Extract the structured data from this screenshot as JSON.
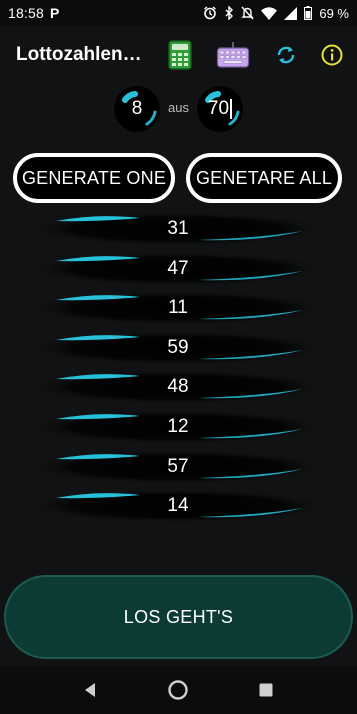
{
  "status_bar": {
    "time": "18:58",
    "app_badge": "P",
    "battery_text": "69 %",
    "icons": [
      "alarm-icon",
      "bluetooth-icon",
      "mute-icon",
      "wifi-icon",
      "signal-icon",
      "battery-icon"
    ]
  },
  "app_bar": {
    "title": "Lottozahlen…",
    "actions": [
      "calculator-icon",
      "keyboard-icon",
      "refresh-icon",
      "info-icon"
    ]
  },
  "selector": {
    "count_value": "8",
    "separator": "aus",
    "max_value": "70"
  },
  "buttons": {
    "generate_one": "GENERATE ONE",
    "generate_all": "GENETARE ALL",
    "go": "LOS GEHT'S"
  },
  "numbers": [
    "31",
    "47",
    "11",
    "59",
    "48",
    "12",
    "57",
    "14"
  ],
  "colors": {
    "accent": "#27c2da",
    "background": "#111213",
    "go_button": "#0c3a34",
    "calculator": "#3bbf4a",
    "keyboard": "#c9a5ef",
    "info": "#e5e23a"
  },
  "nav": {
    "icons": [
      "back-icon",
      "home-icon",
      "recents-icon"
    ]
  }
}
